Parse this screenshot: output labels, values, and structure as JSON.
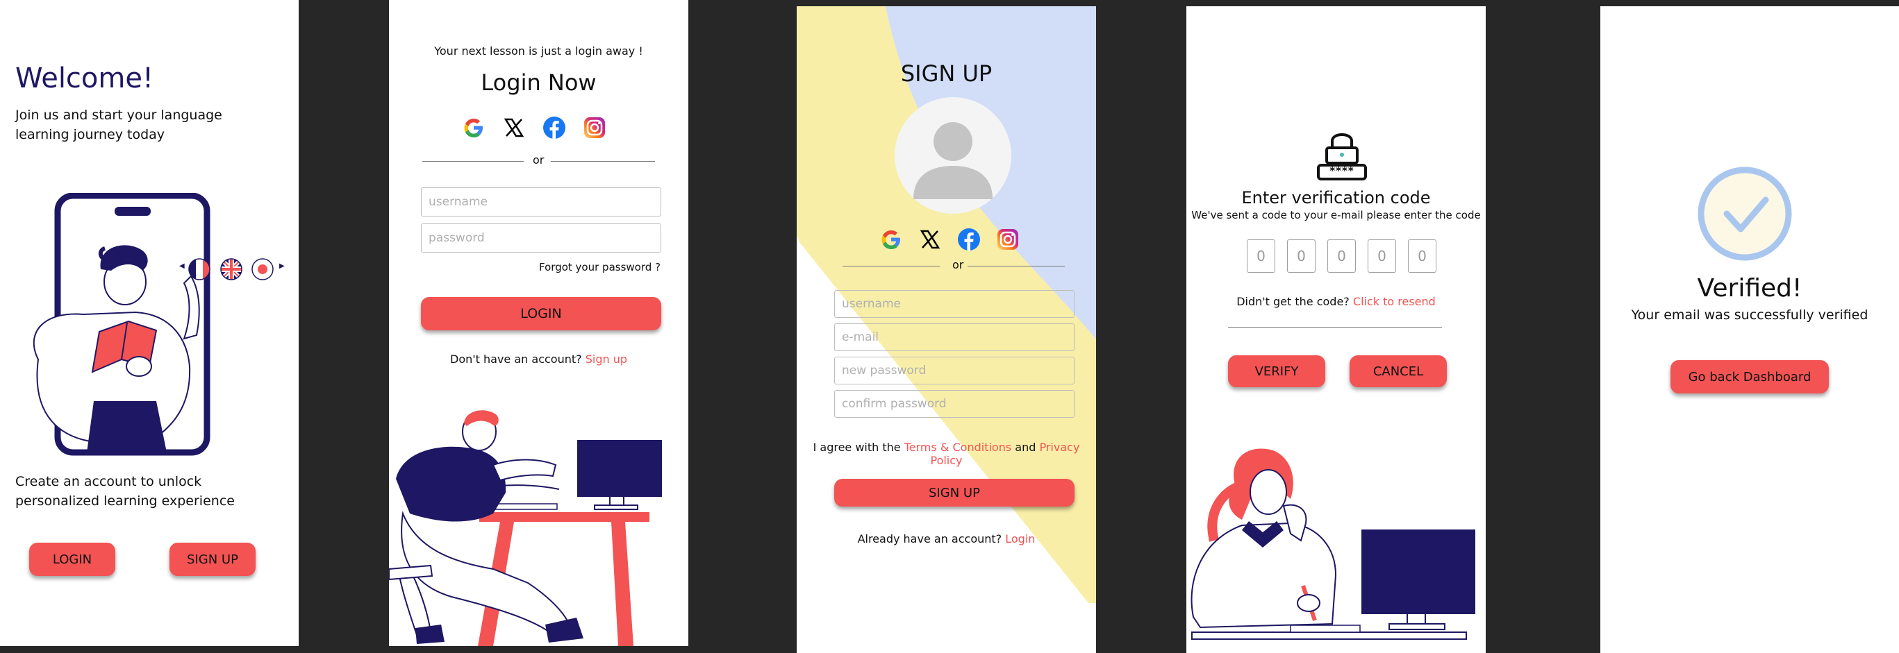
{
  "welcome": {
    "title": "Welcome!",
    "subtitle": "Join us and start your language learning journey today",
    "cta_text": "Create an account to unlock personalized learning experience",
    "login_label": "LOGIN",
    "signup_label": "SIGN UP"
  },
  "login": {
    "tagline": "Your next lesson is just a login away !",
    "title": "Login Now",
    "or": "or",
    "username_placeholder": "username",
    "password_placeholder": "password",
    "forgot": "Forgot your password ?",
    "login_label": "LOGIN",
    "no_account": "Don't have an account?",
    "signup_link": "Sign up"
  },
  "signup": {
    "title": "SIGN UP",
    "or": "or",
    "username_placeholder": "username",
    "email_placeholder": "e-mail",
    "new_password_placeholder": "new password",
    "confirm_password_placeholder": "confirm password",
    "agree_prefix": "I agree with the",
    "terms_link": "Terms & Conditions",
    "and": "and",
    "privacy_link": "Privacy Policy",
    "signup_label": "SIGN UP",
    "have_account": "Already have an account?",
    "login_link": "Login"
  },
  "verify": {
    "title": "Enter verification code",
    "subtitle": "We've sent a code to your e-mail please enter the code",
    "codes": [
      "0",
      "0",
      "0",
      "0",
      "0"
    ],
    "didnt_get": "Didn't get the code?",
    "resend_link": "Click to resend",
    "verify_label": "VERIFY",
    "cancel_label": "CANCEL",
    "lock_code": "****"
  },
  "verified": {
    "title": "Verified!",
    "subtitle": "Your email was successfully verified",
    "button_label": "Go back Dashboard"
  },
  "colors": {
    "accent": "#f35353",
    "navy": "#1e1763",
    "dark_bg": "#272727",
    "check_blue": "#a9c6ee",
    "check_fill": "#fdf8e6",
    "signup_yellow": "#f8eea7",
    "signup_blue": "#d2def8"
  },
  "icons": [
    "google-icon",
    "x-icon",
    "facebook-icon",
    "instagram-icon",
    "lock-icon",
    "check-circle-icon",
    "avatar-icon",
    "flag-france-icon",
    "flag-uk-icon",
    "flag-japan-icon"
  ]
}
